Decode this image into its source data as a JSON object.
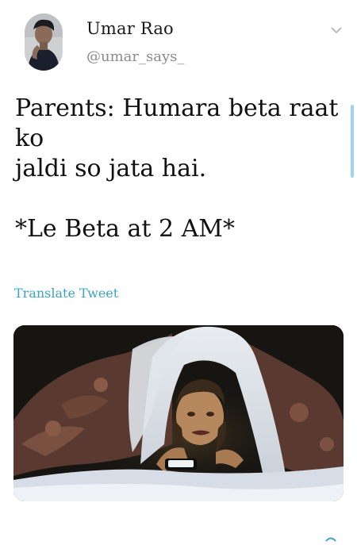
{
  "user": {
    "display_name": "Umar Rao",
    "handle": "@umar_says_",
    "avatar_icon": "avatar-photo"
  },
  "tweet": {
    "lines": [
      "Parents: Humara beta raat",
      "ko",
      "jaldi so jata hai.",
      "",
      "*Le Beta at 2 AM*"
    ]
  },
  "translate_label": "Translate Tweet",
  "media": {
    "description_icon": "meme-image"
  },
  "colors": {
    "link": "#3ba4c6",
    "handle": "#8a8a8a",
    "scroll_indicator": "#9fd3f0"
  }
}
